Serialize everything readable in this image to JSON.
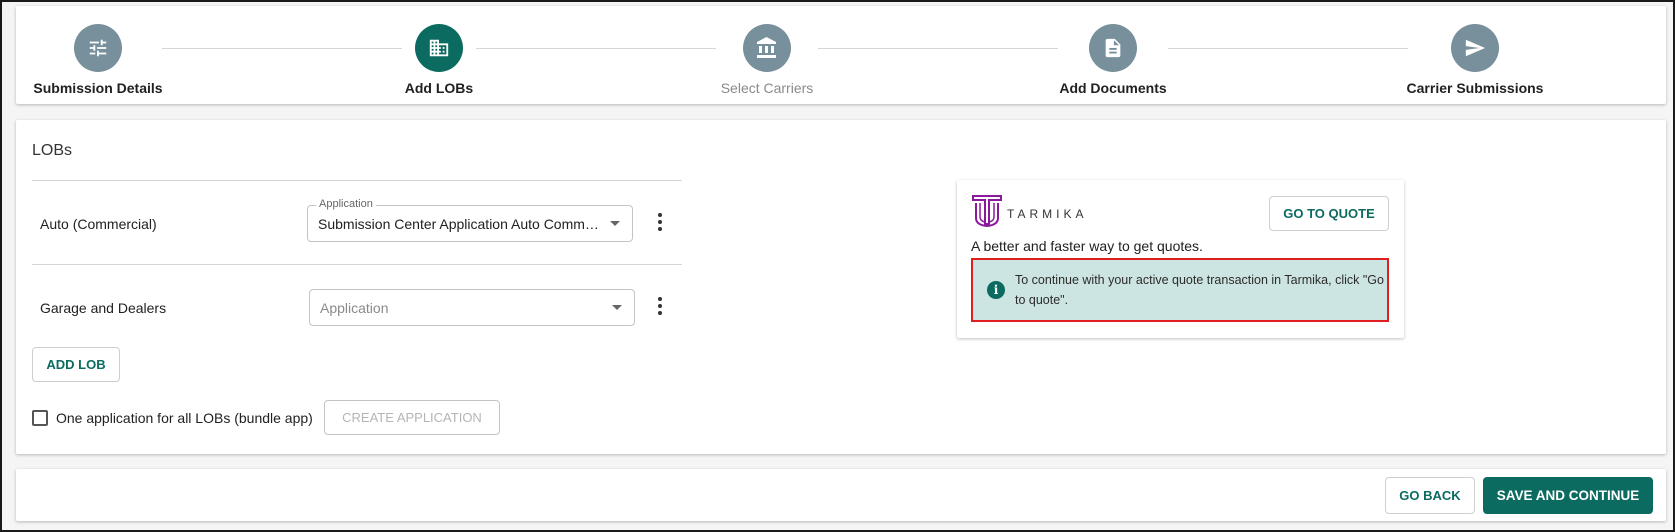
{
  "stepper": {
    "steps": [
      {
        "label": "Submission Details",
        "icon": "sliders-icon",
        "state": "completed",
        "color": "#78909c"
      },
      {
        "label": "Add LOBs",
        "icon": "building-icon",
        "state": "active",
        "color": "#0b6b60"
      },
      {
        "label": "Select Carriers",
        "icon": "bank-icon",
        "state": "inactive",
        "color": "#78909c"
      },
      {
        "label": "Add Documents",
        "icon": "document-icon",
        "state": "completed",
        "color": "#78909c"
      },
      {
        "label": "Carrier Submissions",
        "icon": "send-icon",
        "state": "completed",
        "color": "#78909c"
      }
    ]
  },
  "lobs": {
    "title": "LOBs",
    "items": [
      {
        "name": "Auto (Commercial)",
        "application_label": "Application",
        "application_value": "Submission Center Application Auto Commercial"
      },
      {
        "name": "Garage and Dealers",
        "application_placeholder": "Application",
        "application_value": ""
      }
    ],
    "add_lob_label": "ADD LOB",
    "bundle_checkbox_label": "One application for all LOBs (bundle app)",
    "bundle_checked": false,
    "create_application_label": "CREATE APPLICATION"
  },
  "tarmika": {
    "logo_text": "TARMIKA",
    "go_to_quote_label": "GO TO QUOTE",
    "tagline": "A better and faster way to get quotes.",
    "info_text": "To continue with your active quote transaction in Tarmika, click \"Go to quote\"."
  },
  "footer": {
    "go_back_label": "GO BACK",
    "save_continue_label": "SAVE AND CONTINUE"
  },
  "colors": {
    "accent": "#0b6b60",
    "info_background": "#cde5e2",
    "highlight_border": "#e01e1e",
    "tarmika_brand": "#8a1a9b"
  }
}
